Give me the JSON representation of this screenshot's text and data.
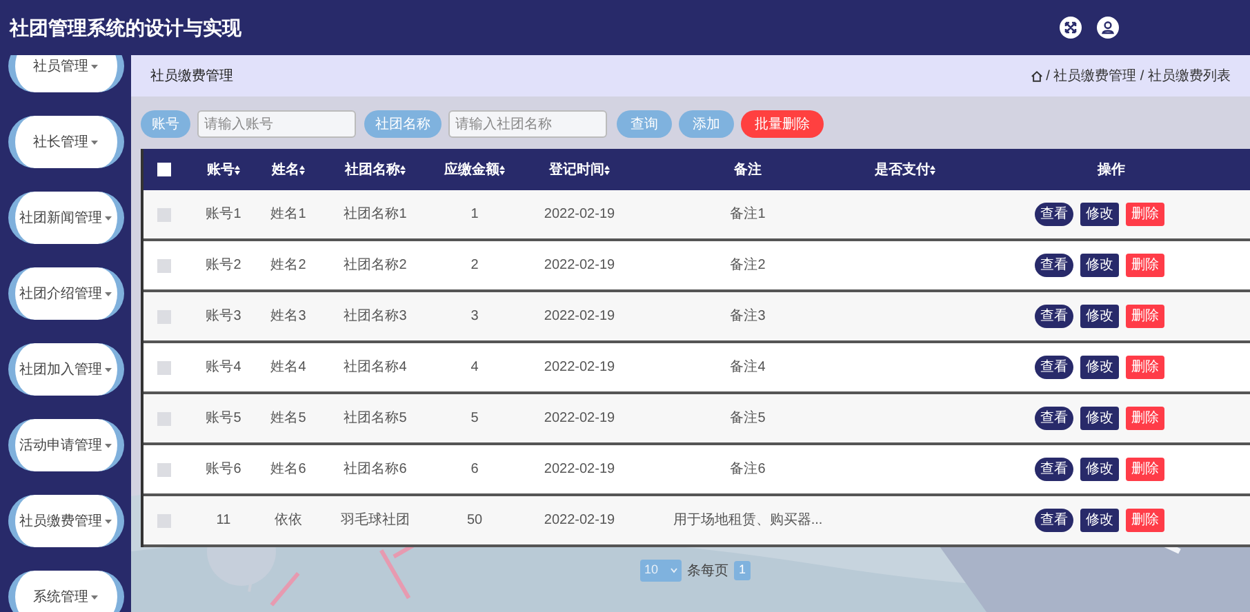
{
  "header": {
    "title": "社团管理系统的设计与实现"
  },
  "sidebar": {
    "items": [
      {
        "label": "社员管理"
      },
      {
        "label": "社长管理"
      },
      {
        "label": "社团新闻管理"
      },
      {
        "label": "社团介绍管理"
      },
      {
        "label": "社团加入管理"
      },
      {
        "label": "活动申请管理"
      },
      {
        "label": "社员缴费管理"
      },
      {
        "label": "系统管理"
      }
    ]
  },
  "breadcrumb": {
    "title": "社员缴费管理",
    "path": "/ 社员缴费管理 / 社员缴费列表"
  },
  "search": {
    "fields": [
      {
        "label": "账号",
        "placeholder": "请输入账号"
      },
      {
        "label": "社团名称",
        "placeholder": "请输入社团名称"
      }
    ],
    "buttons": [
      {
        "label": "查询",
        "kind": "primary"
      },
      {
        "label": "添加",
        "kind": "primary"
      },
      {
        "label": "批量删除",
        "kind": "danger"
      }
    ]
  },
  "table": {
    "header_checked": false,
    "columns": [
      {
        "label": "账号",
        "sortable": true
      },
      {
        "label": "姓名",
        "sortable": true
      },
      {
        "label": "社团名称",
        "sortable": true
      },
      {
        "label": "应缴金额",
        "sortable": true
      },
      {
        "label": "登记时间",
        "sortable": true
      },
      {
        "label": "备注",
        "sortable": false
      },
      {
        "label": "是否支付",
        "sortable": true
      },
      {
        "label": "操作",
        "sortable": false
      }
    ],
    "rows": [
      {
        "checked": false,
        "cells": [
          "账号1",
          "姓名1",
          "社团名称1",
          "1",
          "2022-02-19",
          "备注1"
        ],
        "actions": [
          {
            "label": "查看",
            "kind": "view"
          },
          {
            "label": "修改",
            "kind": "edit"
          },
          {
            "label": "删除",
            "kind": "delete"
          }
        ]
      },
      {
        "checked": false,
        "cells": [
          "账号2",
          "姓名2",
          "社团名称2",
          "2",
          "2022-02-19",
          "备注2"
        ],
        "actions": [
          {
            "label": "查看",
            "kind": "view"
          },
          {
            "label": "修改",
            "kind": "edit"
          },
          {
            "label": "删除",
            "kind": "delete"
          }
        ]
      },
      {
        "checked": false,
        "cells": [
          "账号3",
          "姓名3",
          "社团名称3",
          "3",
          "2022-02-19",
          "备注3"
        ],
        "actions": [
          {
            "label": "查看",
            "kind": "view"
          },
          {
            "label": "修改",
            "kind": "edit"
          },
          {
            "label": "删除",
            "kind": "delete"
          }
        ]
      },
      {
        "checked": false,
        "cells": [
          "账号4",
          "姓名4",
          "社团名称4",
          "4",
          "2022-02-19",
          "备注4"
        ],
        "actions": [
          {
            "label": "查看",
            "kind": "view"
          },
          {
            "label": "修改",
            "kind": "edit"
          },
          {
            "label": "删除",
            "kind": "delete"
          }
        ]
      },
      {
        "checked": false,
        "cells": [
          "账号5",
          "姓名5",
          "社团名称5",
          "5",
          "2022-02-19",
          "备注5"
        ],
        "actions": [
          {
            "label": "查看",
            "kind": "view"
          },
          {
            "label": "修改",
            "kind": "edit"
          },
          {
            "label": "删除",
            "kind": "delete"
          }
        ]
      },
      {
        "checked": false,
        "cells": [
          "账号6",
          "姓名6",
          "社团名称6",
          "6",
          "2022-02-19",
          "备注6"
        ],
        "actions": [
          {
            "label": "查看",
            "kind": "view"
          },
          {
            "label": "修改",
            "kind": "edit"
          },
          {
            "label": "删除",
            "kind": "delete"
          }
        ]
      },
      {
        "checked": false,
        "cells": [
          "11",
          "依依",
          "羽毛球社团",
          "50",
          "2022-02-19",
          "用于场地租赁、购买器..."
        ],
        "actions": [
          {
            "label": "查看",
            "kind": "view"
          },
          {
            "label": "修改",
            "kind": "edit"
          },
          {
            "label": "删除",
            "kind": "delete"
          }
        ]
      }
    ]
  },
  "pagination": {
    "page_size": "10",
    "size_label": "条每页",
    "pages": [
      {
        "label": "1",
        "selected": true
      }
    ]
  }
}
